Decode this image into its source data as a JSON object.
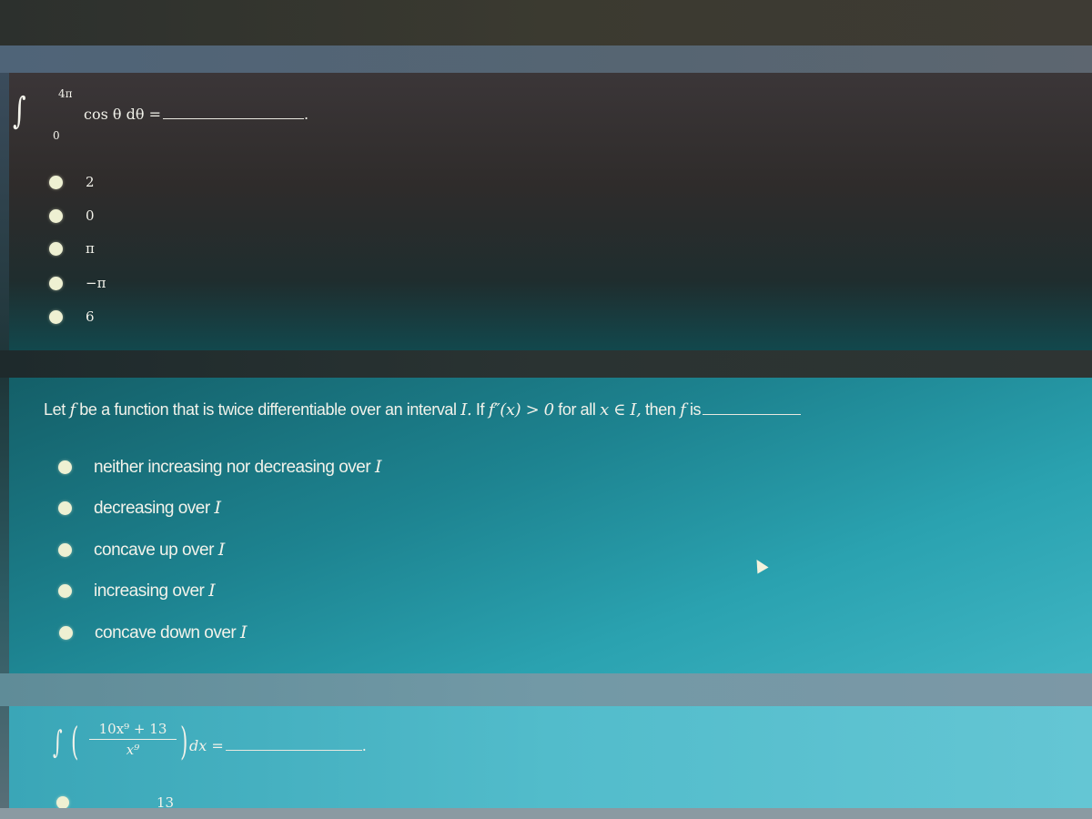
{
  "question_1": {
    "integral": {
      "sign": "∫",
      "upper_limit": "4π",
      "lower_limit": "0",
      "integrand": "cos θ dθ",
      "equals": "="
    },
    "period": ".",
    "options": [
      {
        "label": "2"
      },
      {
        "label": "0"
      },
      {
        "label": "π"
      },
      {
        "label": "−π"
      },
      {
        "label": "6"
      }
    ]
  },
  "question_2": {
    "stem_parts": {
      "p1": "Let ",
      "f1": "f",
      "p2": " be a function that is twice differentiable over an interval ",
      "I1": "I.",
      "p3": " If ",
      "deriv": "f″(x) > 0",
      "p4": " for all ",
      "cond": "x ∈ I,",
      "p5": " then ",
      "f2": "f",
      "p6": " is"
    },
    "options": [
      {
        "text": "neither increasing nor decreasing over ",
        "var": "I"
      },
      {
        "text": "decreasing over ",
        "var": "I"
      },
      {
        "text": "concave up over ",
        "var": "I"
      },
      {
        "text": "increasing over ",
        "var": "I"
      },
      {
        "text": "concave down over ",
        "var": "I"
      }
    ]
  },
  "question_3": {
    "integral": {
      "sign": "∫",
      "left_paren": "(",
      "numerator": "10x⁹ + 13",
      "denominator": "x⁹",
      "right_paren": ")",
      "differential": "dx",
      "equals": "="
    },
    "period": ".",
    "options_visible": [
      {
        "label": "13"
      }
    ]
  },
  "colors": {
    "option_radio": "#eef0d2",
    "text": "#f2f2ea",
    "card_dark": "#2f2c2b",
    "card_teal": "#1d8390",
    "card_light_teal": "#52bccb"
  }
}
